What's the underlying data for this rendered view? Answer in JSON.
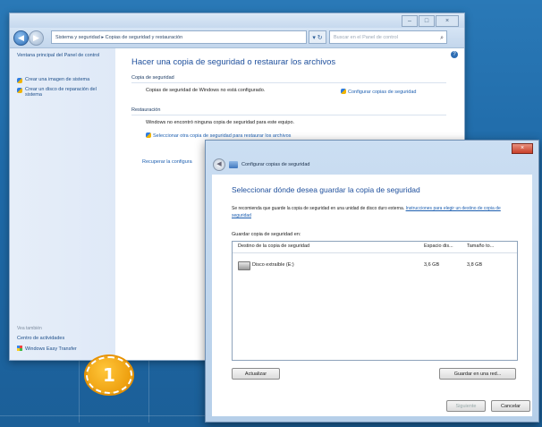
{
  "control_panel": {
    "address": "Sistema y seguridad  ▸  Copias de seguridad y restauración",
    "search_placeholder": "Buscar en el Panel de control",
    "sidebar": {
      "home_link": "Ventana principal del Panel de control",
      "tasks": [
        "Crear una imagen de sistema",
        "Crear un disco de reparación del sistema"
      ],
      "see_also_label": "Vea también",
      "see_also_items": [
        "Centro de actividades",
        "Windows Easy Transfer"
      ]
    },
    "main": {
      "title": "Hacer una copia de seguridad o restaurar los archivos",
      "backup_section": "Copia de seguridad",
      "backup_status": "Copias de seguridad de Windows no está configurado.",
      "configure_link": "Configurar copias de seguridad",
      "restore_section": "Restauración",
      "restore_status": "Windows no encontró ninguna copia de seguridad para este equipo.",
      "select_backup_link": "Seleccionar otra copia de seguridad para restaurar los archivos",
      "recover_link": "Recuperar la configura"
    }
  },
  "dialog": {
    "title": "Configurar copias de seguridad",
    "heading": "Seleccionar dónde desea guardar la copia de seguridad",
    "recommendation": "Se recomienda que guarde la copia de seguridad en una unidad de disco duro externa.",
    "instructions_link": "Instrucciones para elegir un destino de copia de seguridad",
    "list_label": "Guardar copia de seguridad en:",
    "columns": [
      "Destino de la copia de seguridad",
      "Espacio dis...",
      "Tamaño to..."
    ],
    "rows": [
      {
        "destination": "Disco extraíble (E:)",
        "free_space": "3,6 GB",
        "total_size": "3,8 GB"
      }
    ],
    "refresh_button": "Actualizar",
    "save_network_button": "Guardar en una red...",
    "next_button": "Siguiente",
    "cancel_button": "Cancelar"
  },
  "badge": "1"
}
